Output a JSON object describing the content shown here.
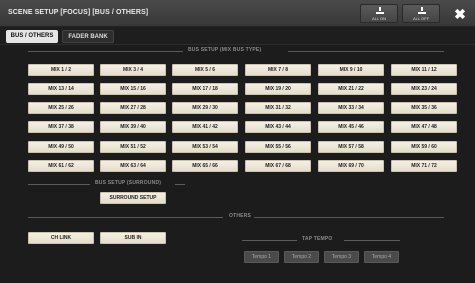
{
  "window": {
    "title": "SCENE SETUP [FOCUS] [BUS / OTHERS]",
    "all_on_label": "ALL ON",
    "all_off_label": "ALL OFF",
    "close_glyph": "✖"
  },
  "tabs": [
    {
      "label": "BUS / OTHERS",
      "active": true
    },
    {
      "label": "FADER BANK",
      "active": false
    }
  ],
  "bus_setup": {
    "header": "BUS SETUP (MIX BUS TYPE)",
    "buttons": [
      "MIX 1 / 2",
      "MIX 3 / 4",
      "MIX 5 / 6",
      "MIX 7 / 8",
      "MIX 9 / 10",
      "MIX 11 / 12",
      "MIX 13 / 14",
      "MIX 15 / 16",
      "MIX 17 / 18",
      "MIX 19 / 20",
      "MIX 21 / 22",
      "MIX 23 / 24",
      "MIX 25 / 26",
      "MIX 27 / 28",
      "MIX 29 / 30",
      "MIX 31 / 32",
      "MIX 33 / 34",
      "MIX 35 / 36",
      "MIX 37 / 38",
      "MIX 39 / 40",
      "MIX 41 / 42",
      "MIX 43 / 44",
      "MIX 45 / 46",
      "MIX 47 / 48",
      "MIX 49 / 50",
      "MIX 51 / 52",
      "MIX 53 / 54",
      "MIX 55 / 56",
      "MIX 57 / 58",
      "MIX 59 / 60",
      "MIX 61 / 62",
      "MIX 63 / 64",
      "MIX 65 / 66",
      "MIX 67 / 68",
      "MIX 69 / 70",
      "MIX 71 / 72"
    ]
  },
  "surround": {
    "header": "BUS SETUP (SURROUND)",
    "button": "SURROUND SETUP"
  },
  "others": {
    "header": "OTHERS",
    "ch_link": "CH LINK",
    "sub_in": "SUB IN"
  },
  "tap_tempo": {
    "header": "TAP TEMPO",
    "buttons": [
      "Tempo 1",
      "Tempo 2",
      "Tempo 3",
      "Tempo 4"
    ]
  },
  "colors": {
    "button_face": "#f0ebdc",
    "background": "#1c1c1c",
    "titlebar": "#404040"
  }
}
